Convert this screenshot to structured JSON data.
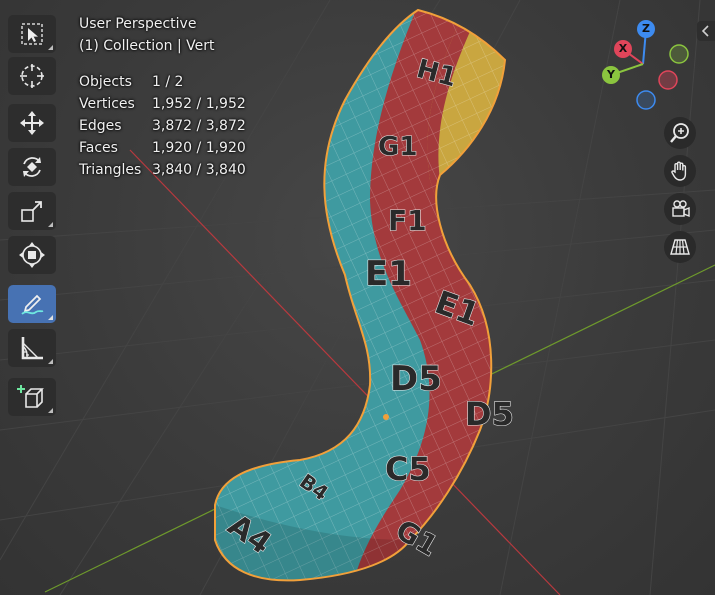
{
  "header": {
    "view_name": "User Perspective",
    "context": "(1) Collection | Vert"
  },
  "stats": [
    {
      "label": "Objects",
      "value": "1 / 2"
    },
    {
      "label": "Vertices",
      "value": "1,952 / 1,952"
    },
    {
      "label": "Edges",
      "value": "3,872 / 3,872"
    },
    {
      "label": "Faces",
      "value": "1,920 / 1,920"
    },
    {
      "label": "Triangles",
      "value": "3,840 / 3,840"
    }
  ],
  "toolbar": {
    "tools": [
      {
        "name": "select-box-tool",
        "icon": "select-box-icon",
        "active": false
      },
      {
        "name": "cursor-tool",
        "icon": "cursor-icon",
        "active": false
      },
      {
        "name": "move-tool",
        "icon": "move-icon",
        "active": false
      },
      {
        "name": "rotate-tool",
        "icon": "rotate-icon",
        "active": false
      },
      {
        "name": "scale-tool",
        "icon": "scale-icon",
        "active": false
      },
      {
        "name": "transform-tool",
        "icon": "transform-icon",
        "active": false
      },
      {
        "name": "annotate-tool",
        "icon": "annotate-icon",
        "active": true
      },
      {
        "name": "measure-tool",
        "icon": "measure-icon",
        "active": false
      },
      {
        "name": "add-cube-tool",
        "icon": "add-cube-icon",
        "active": false
      }
    ]
  },
  "gizmo": {
    "axes": {
      "x": "X",
      "y": "Y",
      "z": "Z"
    },
    "colors": {
      "x": "#e0455a",
      "y": "#8bc53f",
      "z": "#3d8bf0"
    }
  },
  "navigation": [
    {
      "name": "zoom-button",
      "icon": "zoom-icon"
    },
    {
      "name": "pan-button",
      "icon": "hand-icon"
    },
    {
      "name": "camera-view-button",
      "icon": "camera-icon"
    },
    {
      "name": "ortho-toggle-button",
      "icon": "grid-icon"
    }
  ],
  "mesh": {
    "uv_labels": [
      "A4",
      "B4",
      "C5",
      "D5",
      "E1",
      "F1",
      "G1",
      "H1",
      "A4",
      "C5",
      "D5",
      "E1",
      "F1",
      "G1",
      "H1"
    ],
    "colors": {
      "green": "#4f9a55",
      "teal": "#3f9aa0",
      "red": "#a33a3c",
      "yellow": "#c9a640",
      "outline": "#f1a03a"
    }
  }
}
